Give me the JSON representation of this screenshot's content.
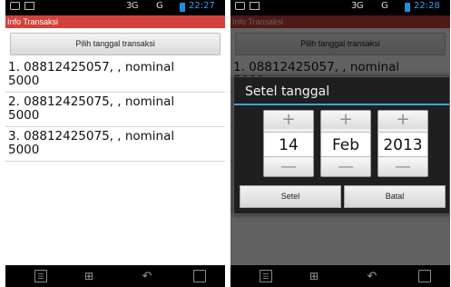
{
  "status_bar": {
    "network": "3G",
    "network2": "G",
    "time_left": "22:27",
    "time_right": "22:28"
  },
  "app": {
    "title": "Info Transaksi",
    "date_button_label": "Pilih tanggal transaksi"
  },
  "transactions": [
    "1. 08812425057, , nominal\n5000",
    "2. 08812425075, , nominal\n5000",
    "3. 08812425075, , nominal\n5000"
  ],
  "date_dialog": {
    "title": "Setel tanggal",
    "day": "14",
    "month": "Feb",
    "year": "2013",
    "increment_symbol": "+",
    "decrement_symbol": "—",
    "set_label": "Setel",
    "cancel_label": "Batal"
  },
  "colors": {
    "title_bar": "#d3413b",
    "clock": "#2aa4f0",
    "dialog_accent": "#3aa7d9"
  },
  "icons": {
    "nav": [
      "menu-icon",
      "home-icon",
      "back-icon",
      "recent-apps-icon"
    ],
    "status": [
      "message-icon",
      "screen-icon",
      "battery-icon"
    ]
  }
}
